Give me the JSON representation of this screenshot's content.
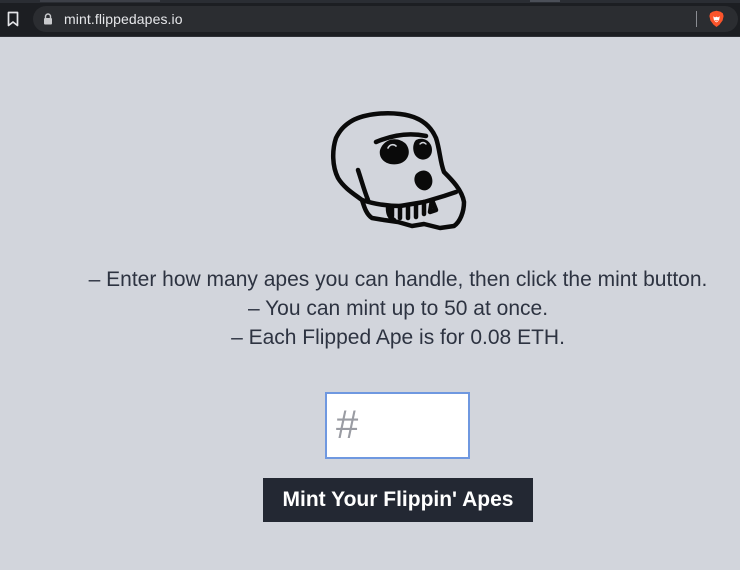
{
  "browser": {
    "url": "mint.flippedapes.io",
    "icons": {
      "bookmark": "bookmark-icon",
      "lock": "lock-icon",
      "shields": "brave-lion-icon"
    },
    "colors": {
      "toolbar": "#1c1e22",
      "address_bar": "#2b2d31",
      "brave_orange": "#fb542b"
    }
  },
  "page": {
    "logo": "ape-skull-logo",
    "instructions": [
      "– Enter how many apes you can handle, then click the mint button.",
      "– You can mint up to 50 at once.",
      "– Each Flipped Ape is for 0.08 ETH."
    ],
    "quantity_input": {
      "value": "",
      "placeholder": "#"
    },
    "mint_button_label": "Mint Your Flippin' Apes",
    "colors": {
      "background": "#d2d5dc",
      "text": "#2d3341",
      "button": "#232833",
      "input_border": "#6f98e0"
    }
  }
}
